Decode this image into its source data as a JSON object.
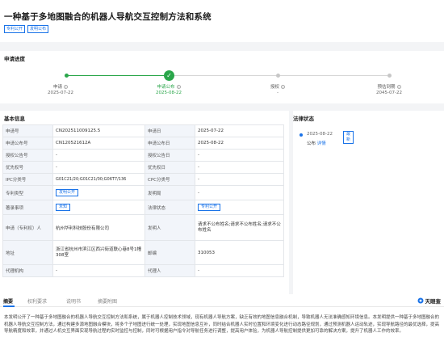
{
  "header": {
    "title": "一种基于多地图融合的机器人导航交互控制方法和系统",
    "tags": [
      "专利公开",
      "发明公布"
    ]
  },
  "progress": {
    "section_title": "申请进度",
    "steps": [
      {
        "label": "申请",
        "date": "2025-07-22",
        "state": "done"
      },
      {
        "label": "申请公布",
        "date": "2025-08-22",
        "state": "current"
      },
      {
        "label": "授权",
        "date": "-",
        "state": "pending"
      },
      {
        "label": "预估到期",
        "date": "2045-07-22",
        "state": "pending"
      }
    ]
  },
  "basic": {
    "section_title": "基本信息",
    "rows": [
      [
        "申请号",
        "CN202511009125.5",
        "申请日",
        "2025-07-22"
      ],
      [
        "申请公布号",
        "CN120521612A",
        "申请公布日",
        "2025-08-22"
      ],
      [
        "授权公告号",
        "-",
        "授权公告日",
        "-"
      ],
      [
        "优先权号",
        "-",
        "优先权日",
        "-"
      ],
      [
        "IPC分类号",
        "G01C21/20;G01C21/00;G06T7/136",
        "CPC分类号",
        "-"
      ],
      [
        "专利类型",
        "发明公开",
        "发明局",
        "-"
      ],
      [
        "著录事项",
        "未知",
        "法律状态",
        "专利公开"
      ],
      [
        "申请（专利权）人",
        "杭州华利科技股份有限公司",
        "发明人",
        "请求不公布姓名;请求不公布姓名;请求不公布姓名"
      ],
      [
        "地址",
        "浙江省杭州市滨江区西兴街道联心巷8号1幢308室",
        "邮编",
        "310053"
      ],
      [
        "代理机构",
        "-",
        "代理人",
        "-"
      ]
    ]
  },
  "legal": {
    "section_title": "法律状态",
    "date": "2025-08-22",
    "chip": "最新",
    "status": "公布",
    "detail_link": "详情"
  },
  "tabs": {
    "items": [
      "摘要",
      "权利要求",
      "说明书",
      "摘要附图"
    ],
    "brand": "天眼查"
  },
  "abstract": "本发明公开了一种基于多地图融合的机器人导航交互控制方法和系统，属于机器人控制技术领域，现有机器人导航方案，缺乏有效的地图信息融合机制，导致机器人无法准确感知环境信息。本发明提供一种基于多地图融合的机器人导航交互控制方法，通过构建多源地图融合模块，将多个子地图进行统一处理，实现地图信息互补，同时结合机器人实时位置和环境变化进行动态路径规划，通过预测机器人运动轨迹，实现导航路径的最优选择，提高导航精度和效率，并通过人机交互界面实现导航过程的实时监控与控制，同时可根据用户指令对导航任务进行调整，提高用户体验，为机器人导航控制提供更加可靠的解决方案，提升了机器人工作的效率。"
}
